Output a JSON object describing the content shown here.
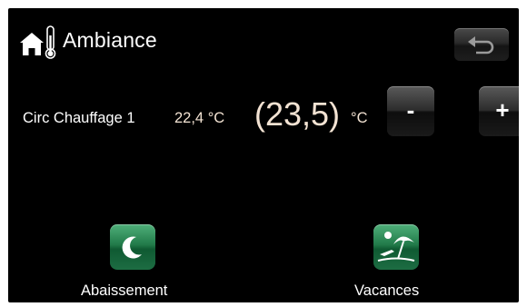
{
  "header": {
    "title": "Ambiance",
    "home_icon": "home-thermometer-icon",
    "back_icon": "return-arrow-icon"
  },
  "circuit": {
    "label": "Circ Chauffage 1",
    "current_temperature": "22,4 °C",
    "setpoint": "(23,5)",
    "setpoint_unit": "°C"
  },
  "controls": {
    "minus_label": "-",
    "plus_label": "+"
  },
  "modes": [
    {
      "label": "Abaissement",
      "icon": "moon-icon"
    },
    {
      "label": "Vacances",
      "icon": "beach-umbrella-icon"
    }
  ],
  "colors": {
    "background": "#000000",
    "text": "#ffffff",
    "temperature_text": "#f3e3d3",
    "mode_button": "#217a49"
  }
}
